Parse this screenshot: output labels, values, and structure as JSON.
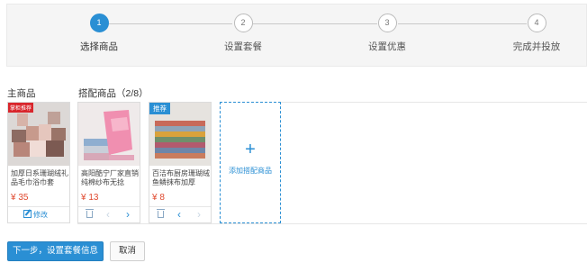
{
  "steps": [
    {
      "number": "1",
      "label": "选择商品",
      "active": true
    },
    {
      "number": "2",
      "label": "设置套餐",
      "active": false
    },
    {
      "number": "3",
      "label": "设置优惠",
      "active": false
    },
    {
      "number": "4",
      "label": "完成并投放",
      "active": false
    }
  ],
  "main_product": {
    "section_title": "主商品",
    "badge": "掌柜推荐",
    "name": "加厚日系珊瑚绒礼品毛巾浴巾套",
    "price": "¥ 35",
    "edit_label": "修改"
  },
  "bundle": {
    "section_title": "搭配商品（2/8）",
    "items": [
      {
        "name": "高阳酷宁厂家直销纯棉纱布无捻",
        "price": "¥ 13",
        "badge": ""
      },
      {
        "name": "百洁布厨房珊瑚绒鱼鳞抹布加厚",
        "price": "¥ 8",
        "badge": "推荐"
      }
    ],
    "add_label": "添加搭配商品",
    "add_icon": "+"
  },
  "icons": {
    "prev": "‹",
    "next": "›"
  },
  "actions": {
    "next_label": "下一步，设置套餐信息",
    "cancel_label": "取消"
  },
  "colors": {
    "accent": "#2a8fd4",
    "price": "#e0492f",
    "badge_red": "#d9262c"
  }
}
